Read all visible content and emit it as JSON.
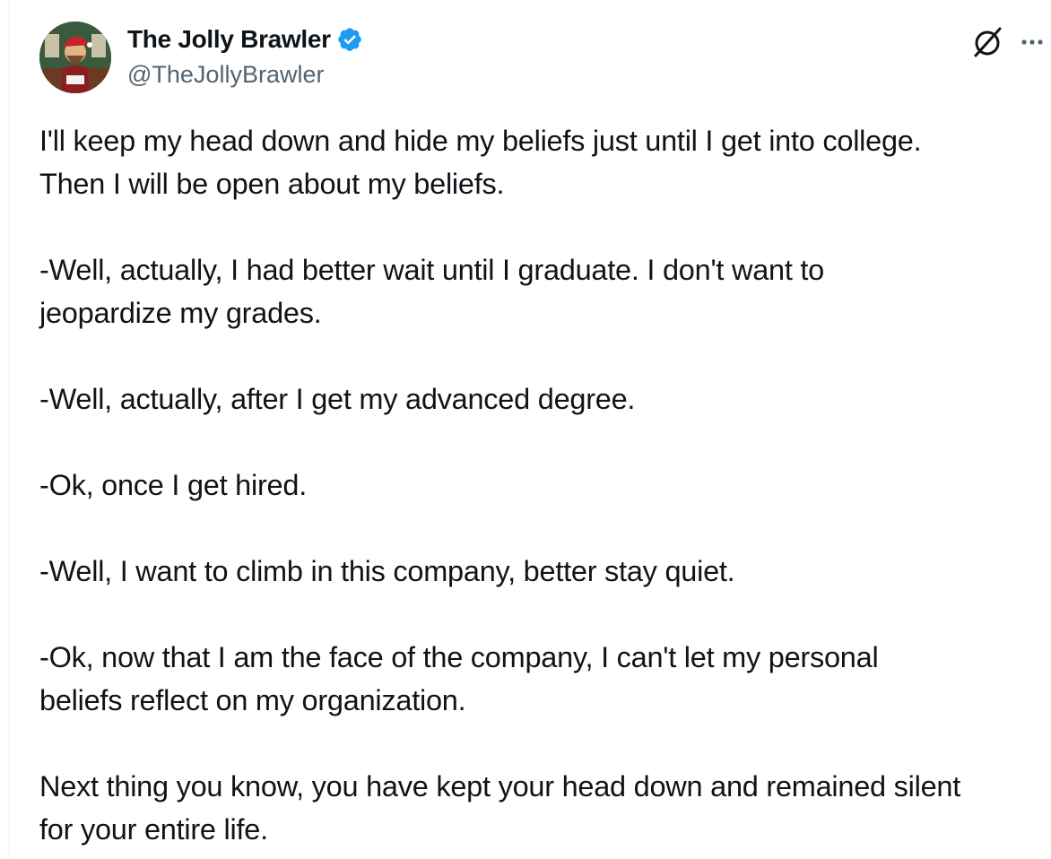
{
  "author": {
    "display_name": "The Jolly Brawler",
    "handle": "@TheJollyBrawler",
    "verified": true,
    "badge_color": "#1d9bf0",
    "avatar_icon": "avatar-image"
  },
  "actions": {
    "grok_icon": "grok-icon",
    "more_icon": "more-icon",
    "more_label": "···"
  },
  "tweet": {
    "paragraphs": [
      {
        "lines": [
          "I'll keep my head down and hide my beliefs just until I get into college.",
          "Then I will be open about my beliefs."
        ]
      },
      {
        "lines": [
          "-Well, actually, I had better wait until I graduate. I don't want to",
          "jeopardize my grades."
        ]
      },
      {
        "lines": [
          "-Well, actually, after I get my advanced degree."
        ]
      },
      {
        "lines": [
          "-Ok, once I get hired."
        ]
      },
      {
        "lines": [
          "-Well, I want to climb in this company, better stay quiet."
        ]
      },
      {
        "lines": [
          "-Ok, now that I am the face of the company, I can't let my personal",
          "beliefs reflect on my organization."
        ]
      },
      {
        "lines": [
          "Next thing you know, you have kept your head down and remained silent",
          "for your entire life."
        ]
      }
    ]
  },
  "colors": {
    "text_primary": "#0f1419",
    "text_secondary": "#536471",
    "accent": "#1d9bf0"
  }
}
